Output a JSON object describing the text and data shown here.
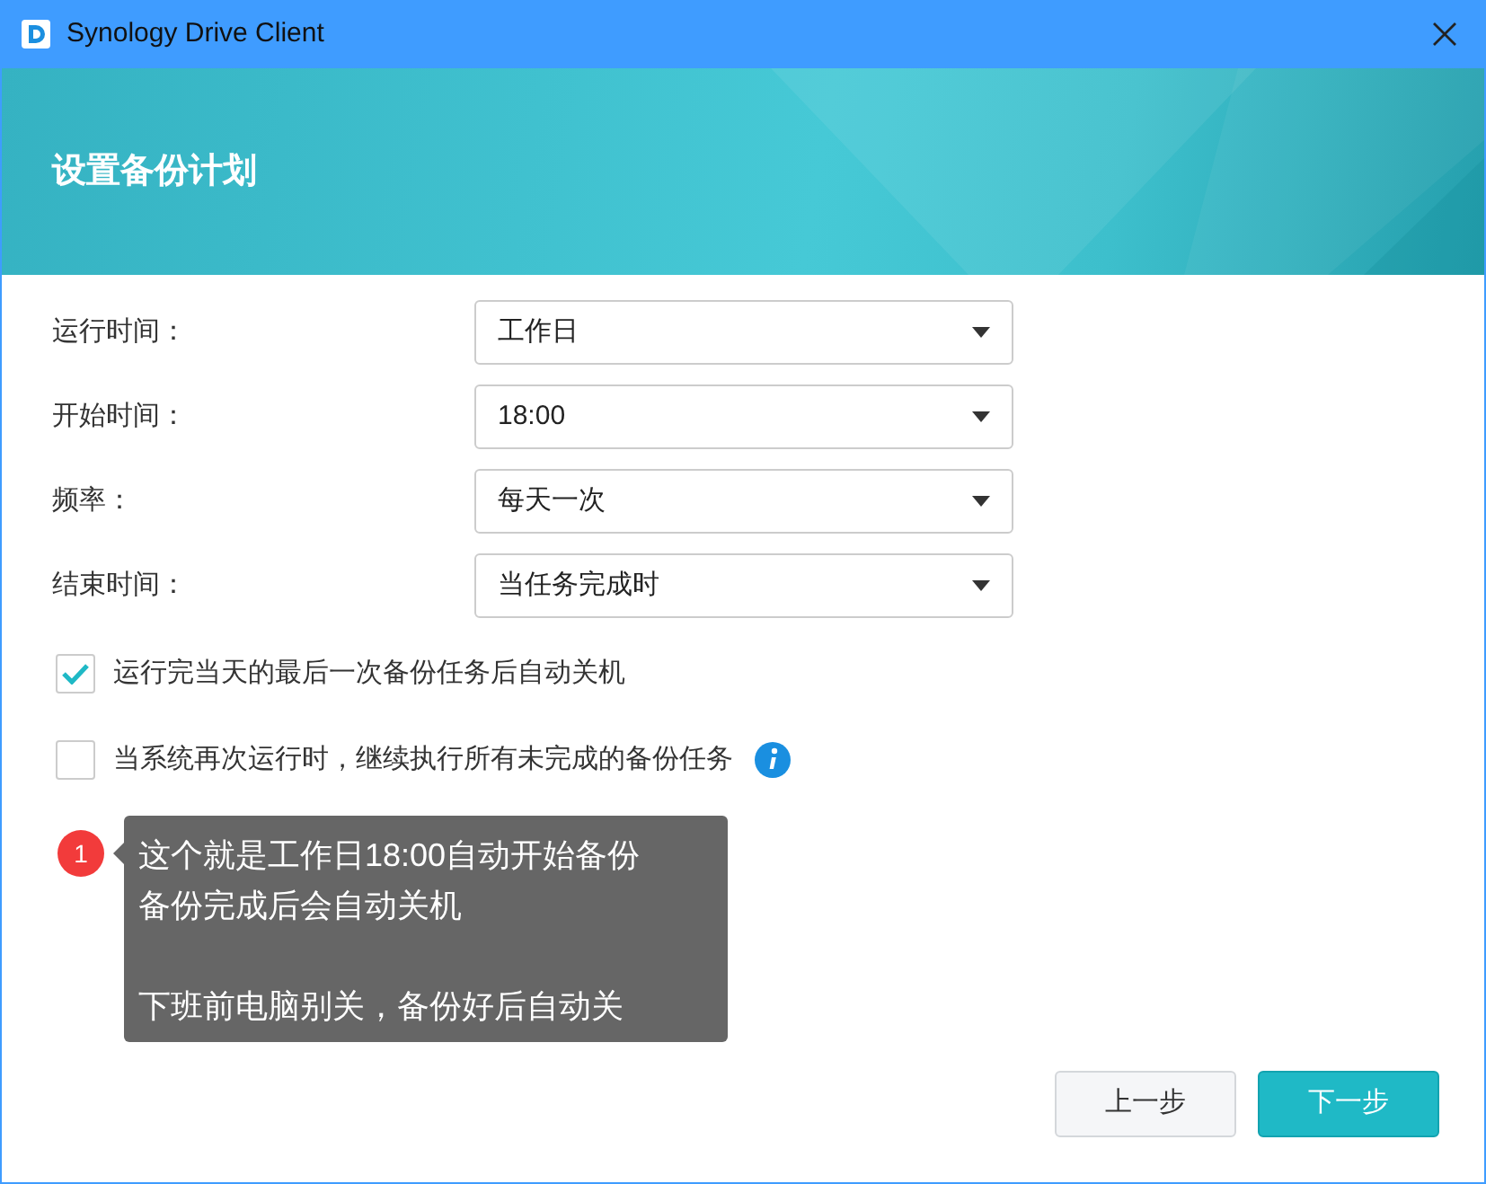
{
  "window": {
    "title": "Synology Drive Client"
  },
  "banner": {
    "title": "设置备份计划"
  },
  "fields": [
    {
      "label": "运行时间：",
      "value": "工作日"
    },
    {
      "label": "开始时间：",
      "value": "18:00"
    },
    {
      "label": "频率：",
      "value": "每天一次"
    },
    {
      "label": "结束时间：",
      "value": "当任务完成时"
    }
  ],
  "options": [
    {
      "label": "运行完当天的最后一次备份任务后自动关机",
      "checked": true,
      "info": false
    },
    {
      "label": "当系统再次运行时，继续执行所有未完成的备份任务",
      "checked": false,
      "info": true
    }
  ],
  "annotation": {
    "number": "1",
    "paragraphs": [
      [
        "这个就是工作日18:00自动开始备份",
        "备份完成后会自动关机"
      ],
      [
        "下班前电脑别关，备份好后自动关"
      ]
    ]
  },
  "buttons": [
    {
      "label": "上一步",
      "kind": "secondary"
    },
    {
      "label": "下一步",
      "kind": "primary"
    }
  ]
}
